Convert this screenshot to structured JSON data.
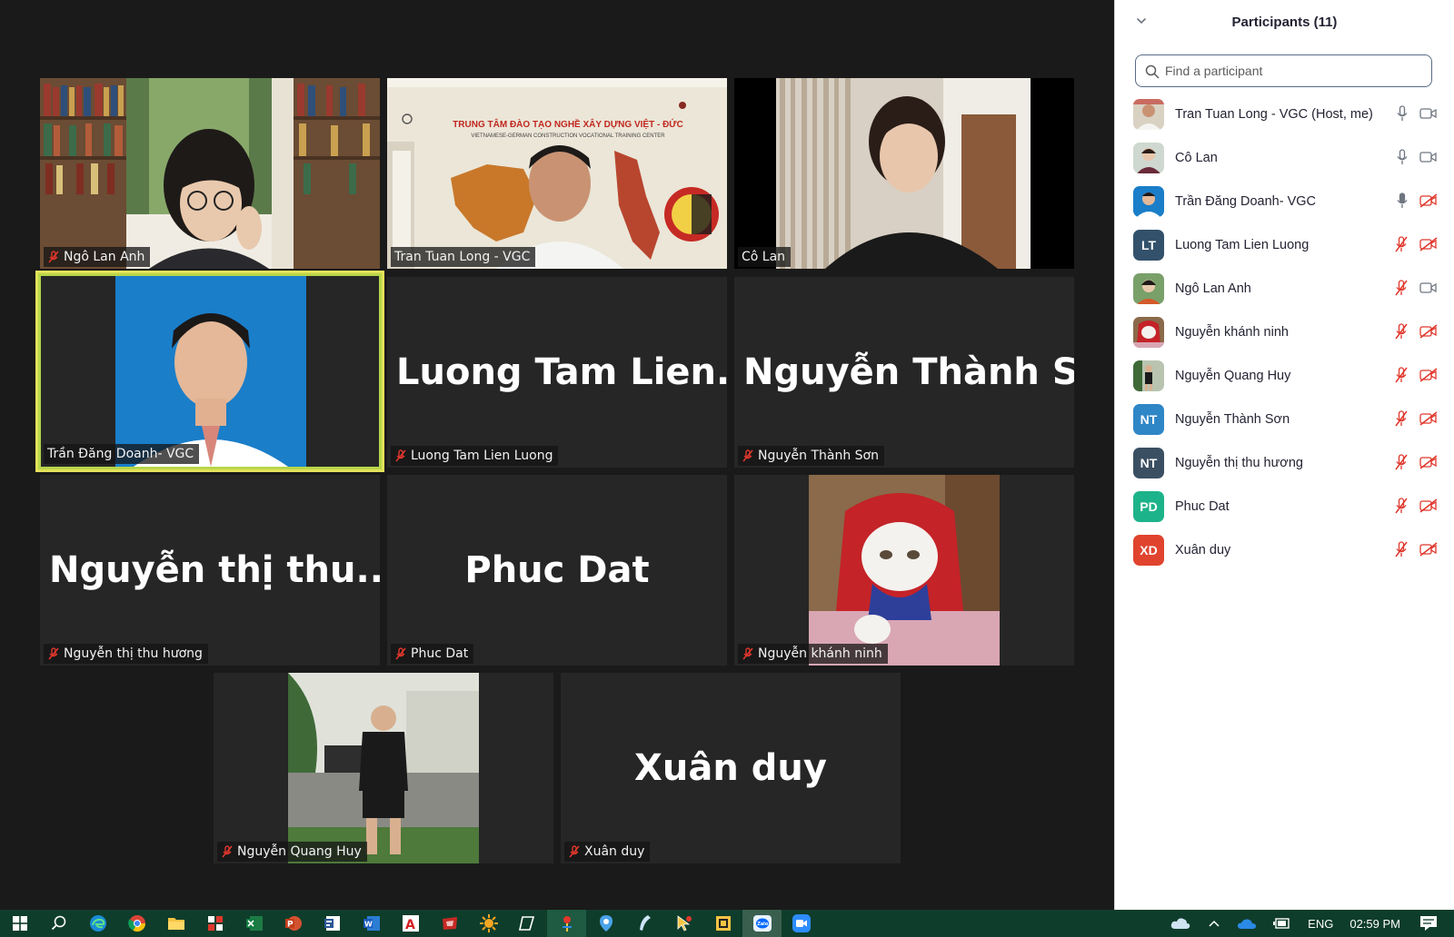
{
  "panel": {
    "title": "Participants (11)",
    "search_placeholder": "Find a participant",
    "participants": [
      {
        "name": "Tran Tuan Long - VGC (Host, me)",
        "avatar": "photo",
        "mic": "on",
        "video": "on"
      },
      {
        "name": "Cô Lan",
        "avatar": "photo",
        "mic": "on",
        "video": "on"
      },
      {
        "name": "Trần Đăng Doanh- VGC",
        "avatar": "photo",
        "mic": "active",
        "video": "off"
      },
      {
        "name": "Luong Tam Lien Luong",
        "initials": "LT",
        "color": "#33516b",
        "mic": "muted",
        "video": "off"
      },
      {
        "name": "Ngô Lan Anh",
        "avatar": "photo",
        "mic": "muted",
        "video": "on"
      },
      {
        "name": "Nguyễn khánh ninh",
        "avatar": "photo",
        "mic": "muted",
        "video": "off"
      },
      {
        "name": "Nguyễn Quang Huy",
        "avatar": "photo",
        "mic": "muted",
        "video": "off"
      },
      {
        "name": "Nguyễn Thành Sơn",
        "initials": "NT",
        "color": "#2f86c6",
        "mic": "muted",
        "video": "off"
      },
      {
        "name": "Nguyễn thị thu hương",
        "initials": "NT",
        "color": "#3b4f63",
        "mic": "muted",
        "video": "off"
      },
      {
        "name": "Phuc Dat",
        "initials": "PD",
        "color": "#1db38a",
        "mic": "muted",
        "video": "off"
      },
      {
        "name": "Xuân duy",
        "initials": "XD",
        "color": "#e0442f",
        "mic": "muted",
        "video": "off"
      }
    ]
  },
  "tiles": [
    {
      "label": "Ngô Lan Anh",
      "muted": true,
      "type": "video"
    },
    {
      "label": "Tran Tuan Long - VGC",
      "muted": false,
      "type": "video",
      "banner_text": "TRUNG TÂM ĐÀO TẠO NGHỀ XÂY DỰNG VIỆT - ĐỨC",
      "banner_sub": "VIETNAMESE-GERMAN CONSTRUCTION VOCATIONAL TRAINING CENTER"
    },
    {
      "label": "Cô Lan",
      "muted": false,
      "type": "video"
    },
    {
      "label": "Trần Đăng Doanh- VGC",
      "muted": false,
      "type": "photo",
      "speaking": true
    },
    {
      "label": "Luong Tam Lien Luong",
      "muted": true,
      "type": "name",
      "display_name": "Luong Tam Lien..."
    },
    {
      "label": "Nguyễn Thành Sơn",
      "muted": true,
      "type": "name",
      "display_name": "Nguyễn Thành S..."
    },
    {
      "label": "Nguyễn thị thu hương",
      "muted": true,
      "type": "name",
      "display_name": "Nguyễn thị thu..."
    },
    {
      "label": "Phuc Dat",
      "muted": true,
      "type": "name",
      "display_name": "Phuc Dat"
    },
    {
      "label": "Nguyễn khánh ninh",
      "muted": true,
      "type": "photo"
    },
    {
      "label": "Nguyễn Quang Huy",
      "muted": true,
      "type": "photo"
    },
    {
      "label": "Xuân duy",
      "muted": true,
      "type": "name",
      "display_name": "Xuân duy"
    }
  ],
  "taskbar": {
    "language": "ENG",
    "time": "02:59 PM",
    "app_icons": [
      "windows-start-icon",
      "search-icon",
      "edge-icon",
      "chrome-icon",
      "file-explorer-icon",
      "app-grid-icon",
      "excel-icon",
      "powerpoint-icon",
      "forms-icon",
      "word-icon",
      "acrobat-icon",
      "app-red-icon",
      "sun-app-icon",
      "snip-icon",
      "pin-app-icon",
      "map-app-icon",
      "pen-app-icon",
      "cursor-app-icon",
      "sticky-notes-icon",
      "zalo-icon",
      "zoom-icon"
    ]
  }
}
